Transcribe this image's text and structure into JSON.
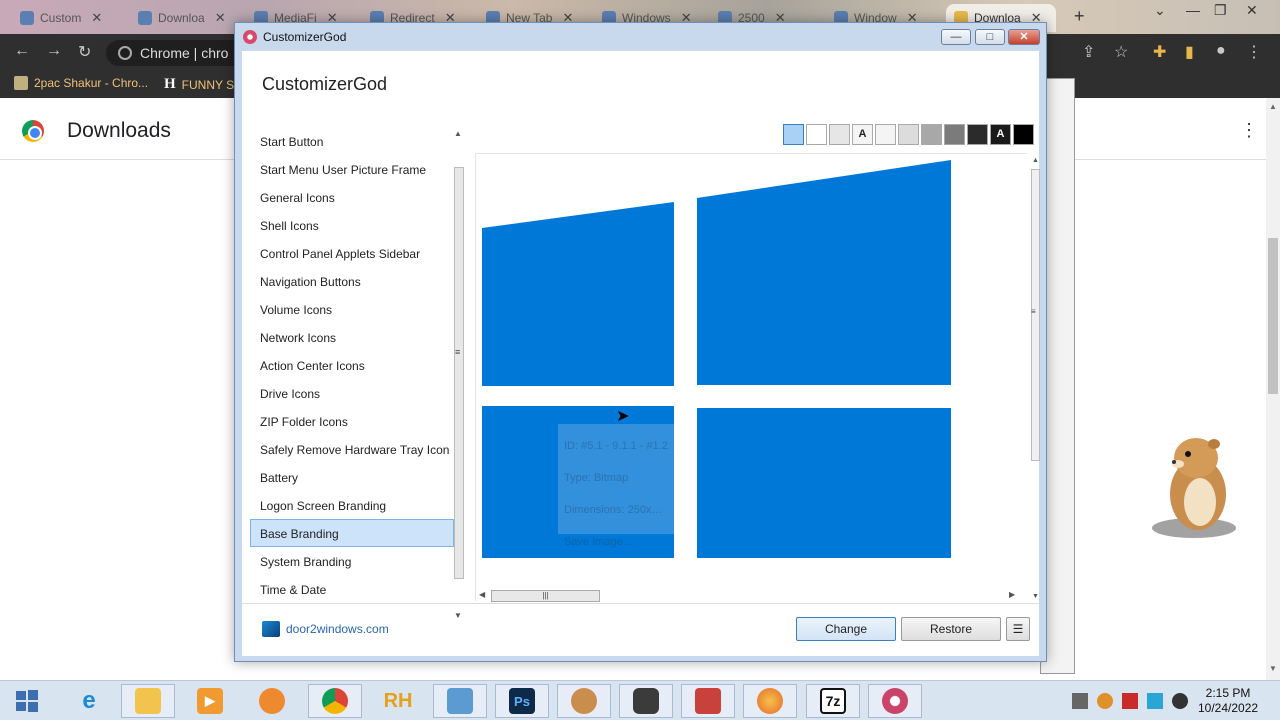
{
  "browser": {
    "tabs": [
      {
        "label": "Custom",
        "active": false
      },
      {
        "label": "Downloa",
        "active": false
      },
      {
        "label": "MediaFi",
        "active": false
      },
      {
        "label": "Redirect",
        "active": false
      },
      {
        "label": "New Tab",
        "active": false
      },
      {
        "label": "Windows",
        "active": false
      },
      {
        "label": "2500",
        "active": false
      },
      {
        "label": "Window",
        "active": false
      },
      {
        "label": "Downloa",
        "active": true
      }
    ],
    "omnibox_text": "Chrome | chro",
    "bookmarks": [
      {
        "label": "2pac Shakur - Chro..."
      },
      {
        "label": "FUNNY S"
      }
    ],
    "page_title": "Downloads"
  },
  "app": {
    "window_title": "CustomizerGod",
    "heading": "CustomizerGod",
    "title_buttons": {
      "minimize": "—",
      "maximize": "□",
      "close": "✕"
    },
    "categories": [
      {
        "label": "Start Button",
        "selected": false
      },
      {
        "label": "Start Menu User Picture Frame",
        "selected": false
      },
      {
        "label": "General Icons",
        "selected": false
      },
      {
        "label": "Shell Icons",
        "selected": false
      },
      {
        "label": "Control Panel Applets Sidebar",
        "selected": false
      },
      {
        "label": "Navigation Buttons",
        "selected": false
      },
      {
        "label": "Volume Icons",
        "selected": false
      },
      {
        "label": "Network Icons",
        "selected": false
      },
      {
        "label": "Action Center Icons",
        "selected": false
      },
      {
        "label": "Drive Icons",
        "selected": false
      },
      {
        "label": "ZIP Folder Icons",
        "selected": false
      },
      {
        "label": "Safely Remove Hardware Tray Icon",
        "selected": false
      },
      {
        "label": "Battery",
        "selected": false
      },
      {
        "label": "Logon Screen Branding",
        "selected": false
      },
      {
        "label": "Base Branding",
        "selected": true
      },
      {
        "label": "System Branding",
        "selected": false
      },
      {
        "label": "Time & Date",
        "selected": false
      }
    ],
    "swatches": [
      {
        "bg": "#a9d1f5",
        "text": "",
        "selected": true
      },
      {
        "bg": "#ffffff",
        "text": ""
      },
      {
        "bg": "#e6e6e6",
        "text": ""
      },
      {
        "bg": "#f4f4f4",
        "text": "A"
      },
      {
        "bg": "#f4f4f4",
        "text": ""
      },
      {
        "bg": "#dcdcdc",
        "text": ""
      },
      {
        "bg": "#a8a8a8",
        "text": ""
      },
      {
        "bg": "#7b7b7b",
        "text": ""
      },
      {
        "bg": "#2b2b2b",
        "text": ""
      },
      {
        "bg": "#1a1a1a",
        "text": "A"
      },
      {
        "bg": "#000000",
        "text": ""
      }
    ],
    "preview_logo_color": "#0078d7",
    "tooltip_lines": [
      "ID: #5.1 - 9.1.1 - #1.2",
      "Type: Bitmap",
      "Dimensions: 250x…",
      "Save Image…"
    ],
    "footer": {
      "site_link": "door2windows.com",
      "change_label": "Change",
      "restore_label": "Restore",
      "menu_label": "☰"
    }
  },
  "taskbar": {
    "apps": [
      "ie",
      "file-explorer",
      "media-player",
      "orange-app",
      "chrome",
      "rh",
      "image-viewer",
      "photoshop",
      "hamster",
      "clock-app",
      "toolbox",
      "firefox",
      "7zip",
      "customizergod"
    ],
    "ps_label": "Ps",
    "rh_label": "RH",
    "zip_label": "7z",
    "time": "2:15 PM",
    "date": "10/24/2022"
  }
}
